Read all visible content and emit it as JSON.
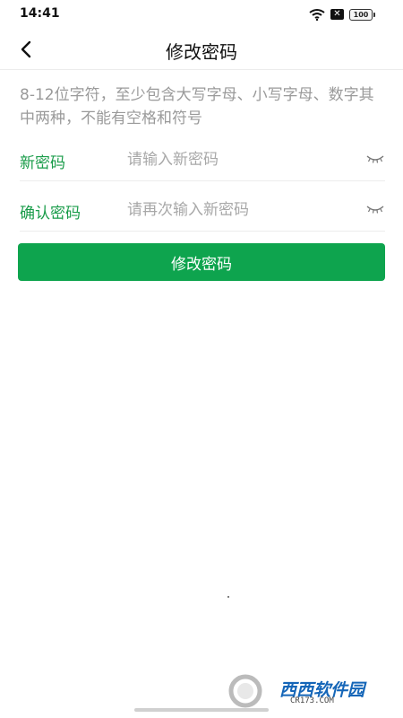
{
  "status_bar": {
    "time": "14:41",
    "battery": "100",
    "icons": [
      "wifi-icon",
      "notification-x-icon",
      "battery-icon"
    ]
  },
  "navbar": {
    "title": "修改密码",
    "back_icon": "chevron-left-icon"
  },
  "hint": "8-12位字符，至少包含大写字母、小写字母、数字其中两种，不能有空格和符号",
  "fields": {
    "new_password": {
      "label": "新密码",
      "placeholder": "请输入新密码",
      "value": "",
      "toggle_icon": "eye-closed-icon"
    },
    "confirm_password": {
      "label": "确认密码",
      "placeholder": "请再次输入新密码",
      "value": "",
      "toggle_icon": "eye-closed-icon"
    }
  },
  "submit": {
    "label": "修改密码"
  },
  "colors": {
    "accent": "#1a9c4a",
    "button": "#0ea44e",
    "hint": "#9a9a9a"
  }
}
